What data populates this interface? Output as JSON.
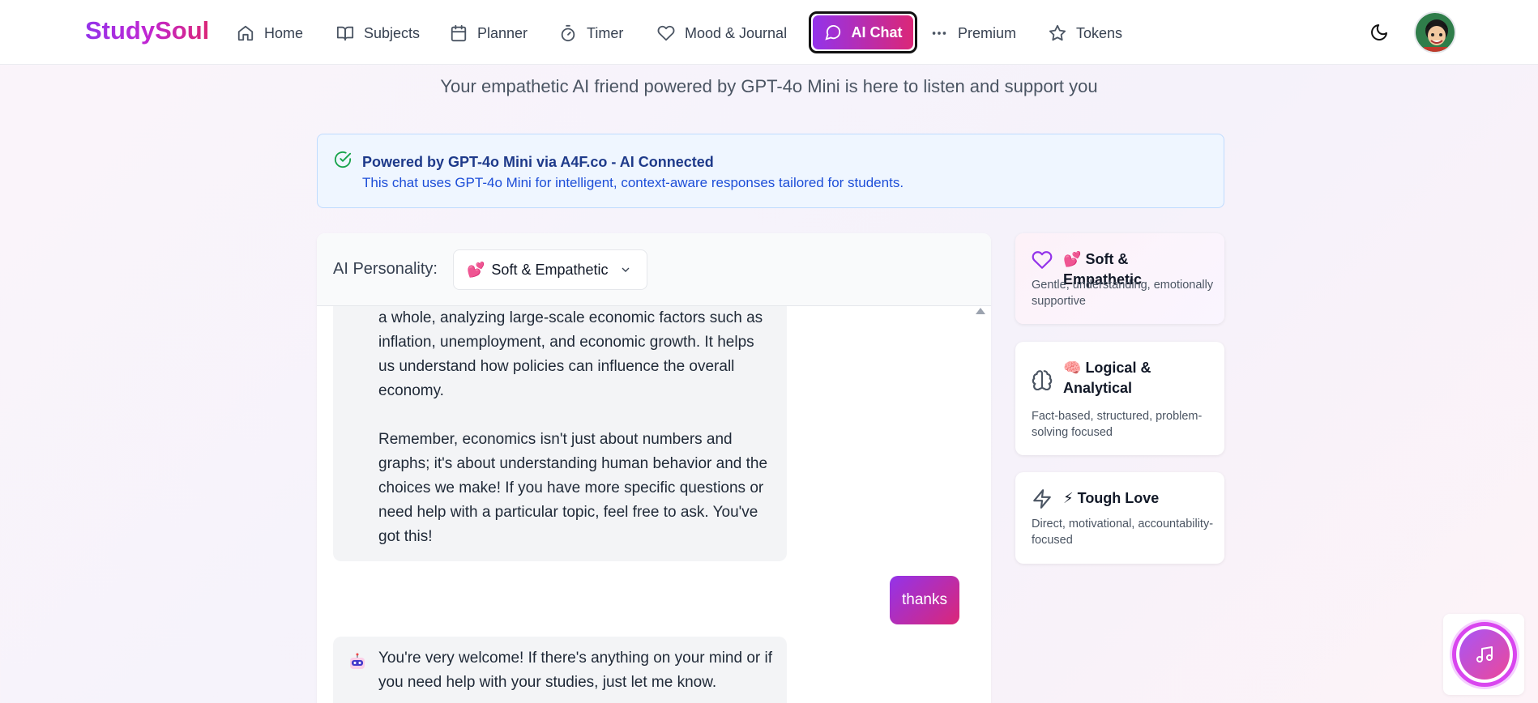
{
  "nav": {
    "logo": "StudySoul",
    "items": [
      {
        "label": "Home",
        "icon": "home-icon"
      },
      {
        "label": "Subjects",
        "icon": "book-open-icon"
      },
      {
        "label": "Planner",
        "icon": "calendar-icon"
      },
      {
        "label": "Timer",
        "icon": "timer-icon"
      },
      {
        "label": "Mood & Journal",
        "icon": "heart-icon"
      },
      {
        "label": "AI Chat",
        "icon": "message-circle-icon",
        "active": true
      },
      {
        "label": "Premium",
        "icon": "more-horizontal-icon"
      },
      {
        "label": "Tokens",
        "icon": "star-icon"
      }
    ],
    "theme_toggle_icon": "moon-icon",
    "avatar_icon": "user-avatar-icon"
  },
  "page": {
    "subtitle": "Your empathetic AI friend powered by GPT-4o Mini is here to listen and support you"
  },
  "banner": {
    "icon": "check-circle-icon",
    "title": "Powered by GPT-4o Mini via A4F.co - AI Connected",
    "text": "This chat uses GPT-4o Mini for intelligent, context-aware responses tailored for students."
  },
  "chat": {
    "personality_label": "AI Personality:",
    "selected_personality": {
      "emoji": "💕",
      "label": "Soft & Empathetic"
    },
    "messages": [
      {
        "role": "assistant",
        "paragraphs": [
          "a whole, analyzing large-scale economic factors such as inflation, unemployment, and economic growth. It helps us understand how policies can influence the overall economy.",
          "Remember, economics isn't just about numbers and graphs; it's about understanding human behavior and the choices we make! If you have more specific questions or need help with a particular topic, feel free to ask. You've got this!"
        ]
      },
      {
        "role": "user",
        "text": "thanks"
      },
      {
        "role": "assistant",
        "avatar_icon": "robot-icon",
        "paragraphs": [
          "You're very welcome! If there's anything on your mind or if you need help with your studies, just let me know."
        ]
      }
    ]
  },
  "personalities": [
    {
      "icon": "heart-icon",
      "emoji": "💕",
      "title": "Soft & Empathetic",
      "desc": "Gentle, understanding, emotionally supportive",
      "active": true,
      "color": "#9333ea"
    },
    {
      "icon": "brain-icon",
      "emoji": "🧠",
      "title": "Logical & Analytical",
      "desc": "Fact-based, structured, problem-solving focused",
      "active": false,
      "color": "#4b5563"
    },
    {
      "icon": "zap-icon",
      "emoji": "⚡",
      "title": "Tough Love",
      "desc": "Direct, motivational, accountability-focused",
      "active": false,
      "color": "#4b5563"
    }
  ],
  "music_button_icon": "music-note-icon"
}
